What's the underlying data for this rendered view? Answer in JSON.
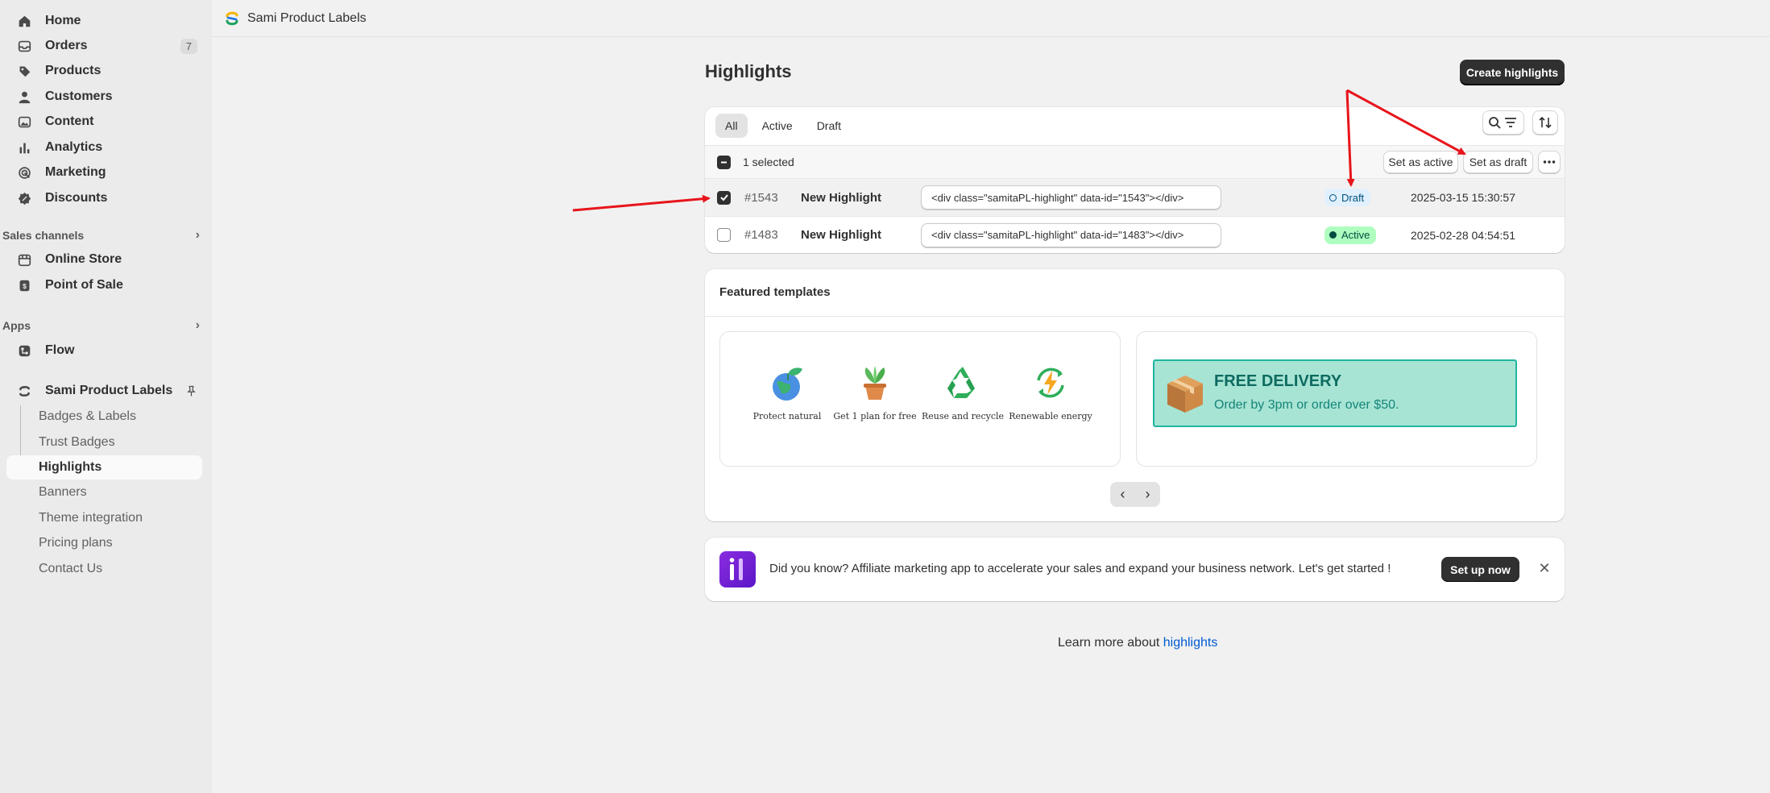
{
  "sidebar": {
    "nav": [
      {
        "label": "Home",
        "icon": "home-icon"
      },
      {
        "label": "Orders",
        "icon": "orders-icon",
        "count": "7"
      },
      {
        "label": "Products",
        "icon": "tag-icon"
      },
      {
        "label": "Customers",
        "icon": "person-icon"
      },
      {
        "label": "Content",
        "icon": "content-icon"
      },
      {
        "label": "Analytics",
        "icon": "chart-icon"
      },
      {
        "label": "Marketing",
        "icon": "target-icon"
      },
      {
        "label": "Discounts",
        "icon": "discount-icon"
      }
    ],
    "sales_channels_label": "Sales channels",
    "sales_channels": [
      {
        "label": "Online Store",
        "icon": "store-icon"
      },
      {
        "label": "Point of Sale",
        "icon": "pos-icon"
      }
    ],
    "apps_label": "Apps",
    "apps": [
      {
        "label": "Flow",
        "icon": "flow-icon"
      },
      {
        "label": "Sami Product Labels",
        "icon": "sami-logo-icon"
      }
    ],
    "app_subitems": [
      "Badges & Labels",
      "Trust Badges",
      "Highlights",
      "Banners",
      "Theme integration",
      "Pricing plans",
      "Contact Us"
    ]
  },
  "header": {
    "app_title": "Sami Product Labels"
  },
  "page": {
    "title": "Highlights",
    "create_button": "Create highlights"
  },
  "table": {
    "tabs": [
      "All",
      "Active",
      "Draft"
    ],
    "selected_text": "1 selected",
    "bulk_actions": {
      "set_active": "Set as active",
      "set_draft": "Set as draft"
    },
    "rows": [
      {
        "id": "#1543",
        "name": "New Highlight",
        "code": "<div class=\"samitaPL-highlight\" data-id=\"1543\"></div>",
        "status": "Draft",
        "date": "2025-03-15 15:30:57",
        "checked": true
      },
      {
        "id": "#1483",
        "name": "New Highlight",
        "code": "<div class=\"samitaPL-highlight\" data-id=\"1483\"></div>",
        "status": "Active",
        "date": "2025-02-28 04:54:51",
        "checked": false
      }
    ]
  },
  "featured": {
    "title": "Featured templates",
    "template1": [
      "Protect natural",
      "Get 1 plan for free",
      "Reuse and recycle",
      "Renewable energy"
    ],
    "template2": {
      "title": "FREE DELIVERY",
      "subtitle": "Order by 3pm or order over $50."
    }
  },
  "promo": {
    "text": "Did you know? Affiliate marketing app to accelerate your sales and expand your business network. Let's get started !",
    "button": "Set up now"
  },
  "learn": {
    "prefix": "Learn more about ",
    "link": "highlights"
  },
  "colors": {
    "accent": "#303030",
    "annotation": "#e8141b",
    "draft_badge": "#e0f0ff",
    "active_badge": "#affebf"
  }
}
